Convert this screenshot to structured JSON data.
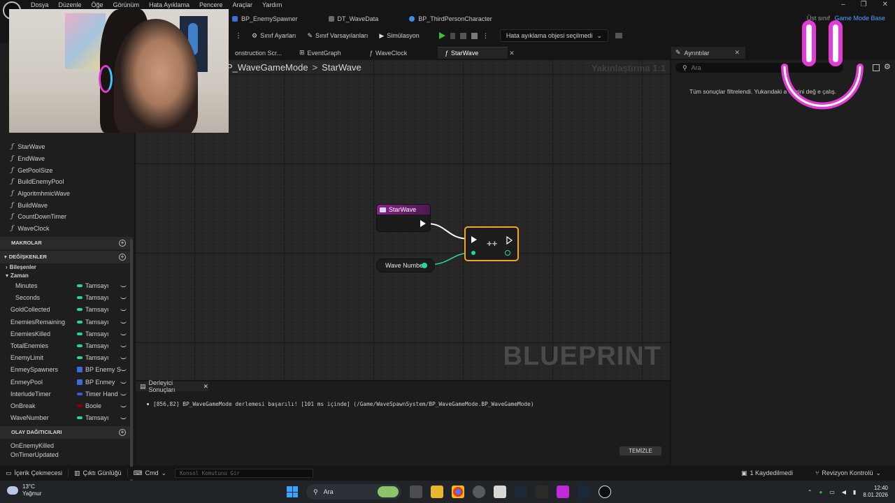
{
  "menu": {
    "items": [
      "Dosya",
      "Düzenle",
      "Öğe",
      "Görünüm",
      "Hata Ayıklama",
      "Pencere",
      "Araçlar",
      "Yardım"
    ]
  },
  "doc_tabs": [
    {
      "label": "BP_EnemySpawner"
    },
    {
      "label": "DT_WaveData"
    },
    {
      "label": "BP_ThirdPersonCharacter"
    }
  ],
  "parent_class": {
    "label": "Üst sınıf",
    "value": "Game Mode Base"
  },
  "toolbar": {
    "class_settings": "Sınıf Ayarları",
    "class_defaults": "Sınıf Varsayılanları",
    "simulation": "Simülasyon",
    "debug_object": "Hata ayıklama objesi seçilmedi"
  },
  "graph_tabs": [
    {
      "label": "onstruction Scr..."
    },
    {
      "label": "EventGraph"
    },
    {
      "label": "WaveClock"
    },
    {
      "label": "StarWave"
    }
  ],
  "graph": {
    "breadcrumb_root": "P_WaveGameMode",
    "breadcrumb_sep": ">",
    "breadcrumb_current": "StarWave",
    "zoom": "Yakınlaştırma 1:1",
    "watermark": "BLUEPRINT",
    "nodes": {
      "entry_title": "StarWave",
      "increment_label": "++",
      "variable_label": "Wave Number"
    }
  },
  "left_panel": {
    "functions": [
      "StarWave",
      "EndWave",
      "GetPoolSize",
      "BuildEnemyPool",
      "AlgoritmhmicWave",
      "BuildWave",
      "CountDownTimer",
      "WaveClock"
    ],
    "function_glyph": "ƒ",
    "macros_header": "MAKROLAR",
    "variables_header": "DEĞİŞKENLER",
    "cat_components": "Bileşenler",
    "cat_time": "Zaman",
    "variables": [
      {
        "name": "Minutes",
        "type": "Tamsayı",
        "sub": true
      },
      {
        "name": "Seconds",
        "type": "Tamsayı",
        "sub": true
      },
      {
        "name": "GoldCollected",
        "type": "Tamsayı"
      },
      {
        "name": "EnemiesRemaining",
        "type": "Tamsayı"
      },
      {
        "name": "EnemiesKilled",
        "type": "Tamsayı"
      },
      {
        "name": "TotalEnemies",
        "type": "Tamsayı"
      },
      {
        "name": "EnemyLimit",
        "type": "Tamsayı"
      },
      {
        "name": "EnmeySpawners",
        "type": "BP Enemy S"
      },
      {
        "name": "EnmeyPool",
        "type": "BP Enmey"
      },
      {
        "name": "InterludeTimer",
        "type": "Timer Hand"
      },
      {
        "name": "OnBreak",
        "type": "Boole"
      },
      {
        "name": "WaveNumber",
        "type": "Tamsayı"
      }
    ],
    "dispatchers_header": "OLAY DAĞITICILARI",
    "dispatchers": [
      "OnEnemyKilled",
      "OnTimerUpdated"
    ]
  },
  "details": {
    "tab": "Ayrıntılar",
    "search_placeholder": "Ara",
    "message": "Tüm sonuçlar filtrelendi. Yukarıdaki a  elerini değ   e çalış."
  },
  "compiler": {
    "tab": "Derleyici Sonuçları",
    "message": "[856,82] BP_WaveGameMode derlemesi başarılı! [101 ms içinde] (/Game/WaveSpawnSystem/BP_WaveGameMode.BP_WaveGameMode)",
    "clear": "TEMİZLE"
  },
  "status": {
    "content_drawer": "İçerik Çekmecesi",
    "output_log": "Çıktı Günlüğü",
    "cmd": "Cmd",
    "console_placeholder": "Konsol Komutunu Gir",
    "saved": "1 Kaydedilmedi",
    "revision": "Revizyon Kontrolü"
  },
  "taskbar": {
    "temperature": "13°C",
    "weather": "Yağmur",
    "search": "Ara",
    "time": "12:40",
    "date": "8.01.2026"
  },
  "colors": {
    "accent": "#f2a51f",
    "event_header": "#8a1f8f",
    "integer_pin": "#1fd9a3",
    "link": "#4aa3ff",
    "play": "#3dbb3d"
  }
}
